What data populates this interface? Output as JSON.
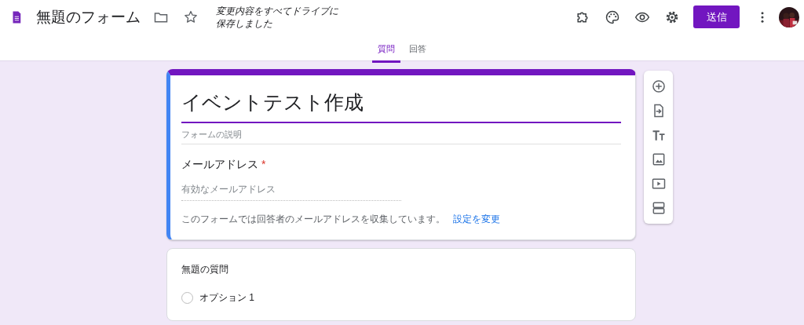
{
  "header": {
    "title": "無題のフォーム",
    "save_status": [
      "変更内容をすべてドライブに",
      "保存しました"
    ],
    "send_button": "送信"
  },
  "tabs": [
    {
      "label": "質問",
      "selected": true
    },
    {
      "label": "回答",
      "selected": false
    }
  ],
  "form_header": {
    "title": "イベントテスト作成",
    "description_placeholder": "フォームの説明",
    "email_label": "メールアドレス",
    "required_mark": "*",
    "email_placeholder": "有効なメールアドレス",
    "notice": "このフォームでは回答者のメールアドレスを収集しています。",
    "notice_link": "設定を変更"
  },
  "question": {
    "title": "無題の質問",
    "options": [
      {
        "label": "オプション 1",
        "selected": false
      }
    ]
  }
}
